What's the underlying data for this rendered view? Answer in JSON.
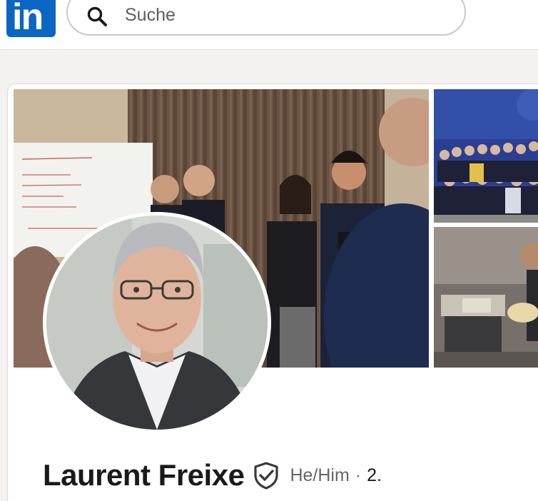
{
  "app": {
    "logo_text": "in",
    "brand_color": "#0a66c2"
  },
  "search": {
    "placeholder": "Suche",
    "value": ""
  },
  "profile": {
    "name": "Laurent Freixe",
    "pronouns": "He/Him",
    "separator": "·",
    "connection_degree": "2.",
    "verified_icon": "verified-shield-check-icon"
  }
}
